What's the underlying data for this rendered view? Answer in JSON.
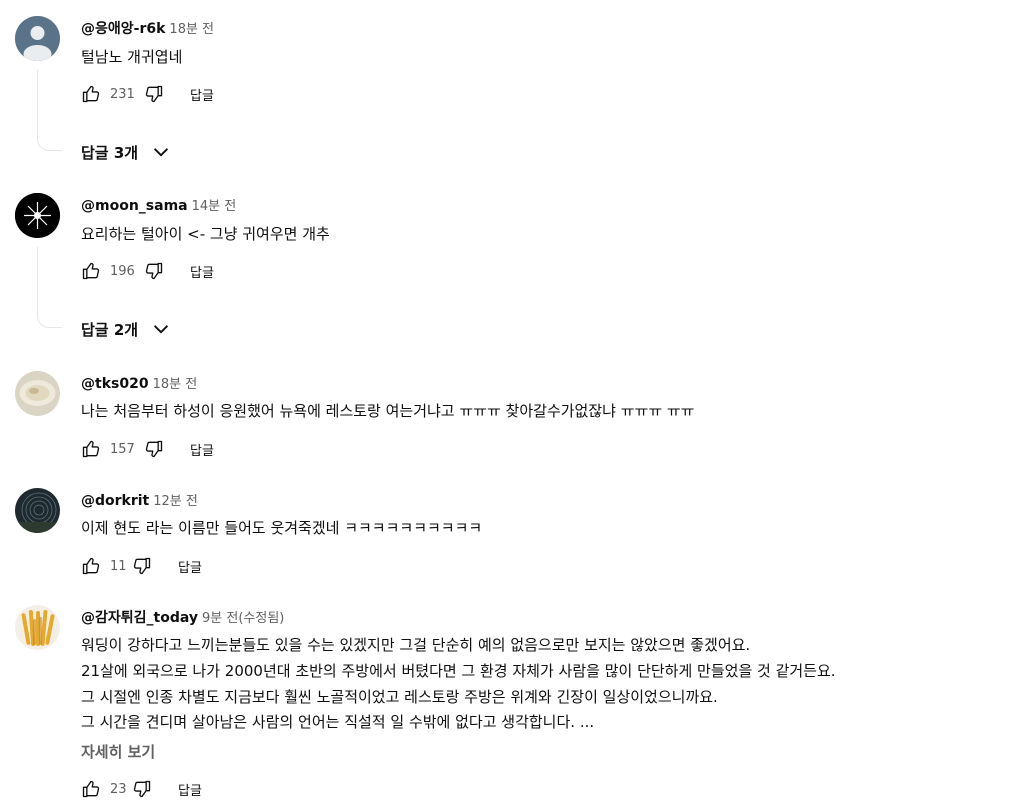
{
  "comments": [
    {
      "author": "@응애앙-r6k",
      "time": "18분 전",
      "lines": [
        "털남노 개귀엽네"
      ],
      "likes": "231",
      "reply_label": "답글",
      "replies_toggle": "답글 3개"
    },
    {
      "author": "@moon_sama",
      "time": "14분 전",
      "lines": [
        "요리하는 털아이 <- 그냥 귀여우면 개추"
      ],
      "likes": "196",
      "reply_label": "답글",
      "replies_toggle": "답글 2개"
    },
    {
      "author": "@tks020",
      "time": "18분 전",
      "lines": [
        "나는 처음부터 하성이 응원했어 뉴욕에 레스토랑 여는거냐고 ㅠㅠㅠ 찾아갈수가없잖냐 ㅠㅠㅠ ㅠㅠ"
      ],
      "likes": "157",
      "reply_label": "답글"
    },
    {
      "author": "@dorkrit",
      "time": "12분 전",
      "lines": [
        "이제 현도 라는 이름만 들어도 웃겨죽겠네 ㅋㅋㅋㅋㅋㅋㅋㅋㅋㅋ"
      ],
      "likes": "11",
      "reply_label": "답글"
    },
    {
      "author": "@감자튀김_today",
      "time": "9분 전(수정됨)",
      "lines": [
        "워딩이 강하다고 느끼는분들도 있을 수는 있겠지만 그걸 단순히 예의 없음으로만 보지는 않았으면 좋겠어요.",
        "21살에 외국으로 나가 2000년대 초반의 주방에서 버텼다면 그 환경 자체가 사람을 많이 단단하게 만들었을 것 같거든요.",
        "그 시절엔 인종 차별도 지금보다 훨씬 노골적이었고 레스토랑 주방은 위계와 긴장이 일상이었으니까요.",
        "그 시간을 견디며 살아남은 사람의 언어는 직설적 일 수밖에 없다고 생각합니다. ..."
      ],
      "more_label": "자세히 보기",
      "likes": "23",
      "reply_label": "답글"
    }
  ],
  "icons": {
    "like": "thumbs-up-icon",
    "dislike": "thumbs-down-icon",
    "expand": "chevron-down-icon"
  }
}
